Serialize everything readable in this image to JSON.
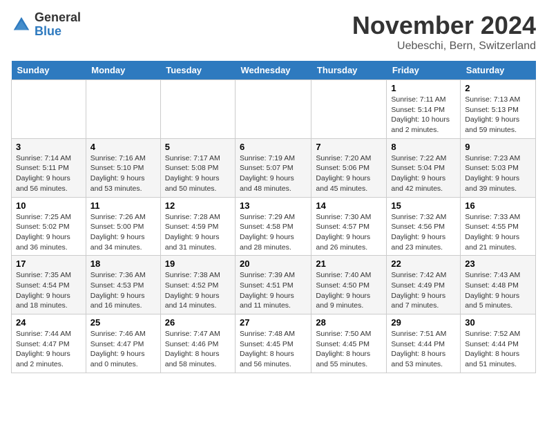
{
  "logo": {
    "general": "General",
    "blue": "Blue"
  },
  "title": "November 2024",
  "location": "Uebeschi, Bern, Switzerland",
  "days_of_week": [
    "Sunday",
    "Monday",
    "Tuesday",
    "Wednesday",
    "Thursday",
    "Friday",
    "Saturday"
  ],
  "weeks": [
    [
      {
        "day": "",
        "info": ""
      },
      {
        "day": "",
        "info": ""
      },
      {
        "day": "",
        "info": ""
      },
      {
        "day": "",
        "info": ""
      },
      {
        "day": "",
        "info": ""
      },
      {
        "day": "1",
        "info": "Sunrise: 7:11 AM\nSunset: 5:14 PM\nDaylight: 10 hours and 2 minutes."
      },
      {
        "day": "2",
        "info": "Sunrise: 7:13 AM\nSunset: 5:13 PM\nDaylight: 9 hours and 59 minutes."
      }
    ],
    [
      {
        "day": "3",
        "info": "Sunrise: 7:14 AM\nSunset: 5:11 PM\nDaylight: 9 hours and 56 minutes."
      },
      {
        "day": "4",
        "info": "Sunrise: 7:16 AM\nSunset: 5:10 PM\nDaylight: 9 hours and 53 minutes."
      },
      {
        "day": "5",
        "info": "Sunrise: 7:17 AM\nSunset: 5:08 PM\nDaylight: 9 hours and 50 minutes."
      },
      {
        "day": "6",
        "info": "Sunrise: 7:19 AM\nSunset: 5:07 PM\nDaylight: 9 hours and 48 minutes."
      },
      {
        "day": "7",
        "info": "Sunrise: 7:20 AM\nSunset: 5:06 PM\nDaylight: 9 hours and 45 minutes."
      },
      {
        "day": "8",
        "info": "Sunrise: 7:22 AM\nSunset: 5:04 PM\nDaylight: 9 hours and 42 minutes."
      },
      {
        "day": "9",
        "info": "Sunrise: 7:23 AM\nSunset: 5:03 PM\nDaylight: 9 hours and 39 minutes."
      }
    ],
    [
      {
        "day": "10",
        "info": "Sunrise: 7:25 AM\nSunset: 5:02 PM\nDaylight: 9 hours and 36 minutes."
      },
      {
        "day": "11",
        "info": "Sunrise: 7:26 AM\nSunset: 5:00 PM\nDaylight: 9 hours and 34 minutes."
      },
      {
        "day": "12",
        "info": "Sunrise: 7:28 AM\nSunset: 4:59 PM\nDaylight: 9 hours and 31 minutes."
      },
      {
        "day": "13",
        "info": "Sunrise: 7:29 AM\nSunset: 4:58 PM\nDaylight: 9 hours and 28 minutes."
      },
      {
        "day": "14",
        "info": "Sunrise: 7:30 AM\nSunset: 4:57 PM\nDaylight: 9 hours and 26 minutes."
      },
      {
        "day": "15",
        "info": "Sunrise: 7:32 AM\nSunset: 4:56 PM\nDaylight: 9 hours and 23 minutes."
      },
      {
        "day": "16",
        "info": "Sunrise: 7:33 AM\nSunset: 4:55 PM\nDaylight: 9 hours and 21 minutes."
      }
    ],
    [
      {
        "day": "17",
        "info": "Sunrise: 7:35 AM\nSunset: 4:54 PM\nDaylight: 9 hours and 18 minutes."
      },
      {
        "day": "18",
        "info": "Sunrise: 7:36 AM\nSunset: 4:53 PM\nDaylight: 9 hours and 16 minutes."
      },
      {
        "day": "19",
        "info": "Sunrise: 7:38 AM\nSunset: 4:52 PM\nDaylight: 9 hours and 14 minutes."
      },
      {
        "day": "20",
        "info": "Sunrise: 7:39 AM\nSunset: 4:51 PM\nDaylight: 9 hours and 11 minutes."
      },
      {
        "day": "21",
        "info": "Sunrise: 7:40 AM\nSunset: 4:50 PM\nDaylight: 9 hours and 9 minutes."
      },
      {
        "day": "22",
        "info": "Sunrise: 7:42 AM\nSunset: 4:49 PM\nDaylight: 9 hours and 7 minutes."
      },
      {
        "day": "23",
        "info": "Sunrise: 7:43 AM\nSunset: 4:48 PM\nDaylight: 9 hours and 5 minutes."
      }
    ],
    [
      {
        "day": "24",
        "info": "Sunrise: 7:44 AM\nSunset: 4:47 PM\nDaylight: 9 hours and 2 minutes."
      },
      {
        "day": "25",
        "info": "Sunrise: 7:46 AM\nSunset: 4:47 PM\nDaylight: 9 hours and 0 minutes."
      },
      {
        "day": "26",
        "info": "Sunrise: 7:47 AM\nSunset: 4:46 PM\nDaylight: 8 hours and 58 minutes."
      },
      {
        "day": "27",
        "info": "Sunrise: 7:48 AM\nSunset: 4:45 PM\nDaylight: 8 hours and 56 minutes."
      },
      {
        "day": "28",
        "info": "Sunrise: 7:50 AM\nSunset: 4:45 PM\nDaylight: 8 hours and 55 minutes."
      },
      {
        "day": "29",
        "info": "Sunrise: 7:51 AM\nSunset: 4:44 PM\nDaylight: 8 hours and 53 minutes."
      },
      {
        "day": "30",
        "info": "Sunrise: 7:52 AM\nSunset: 4:44 PM\nDaylight: 8 hours and 51 minutes."
      }
    ]
  ]
}
